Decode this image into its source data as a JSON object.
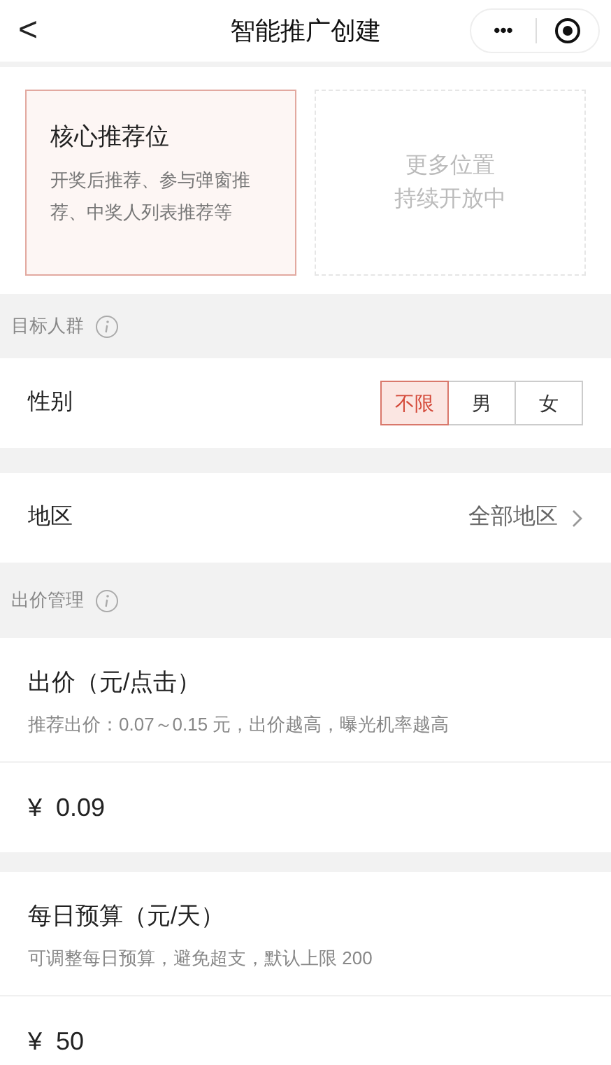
{
  "header": {
    "back": "<",
    "title": "智能推广创建",
    "more": "•••"
  },
  "placements": [
    {
      "kind": "option",
      "selected": true,
      "title": "核心推荐位",
      "description": "开奖后推荐、参与弹窗推荐、中奖人列表推荐等"
    },
    {
      "kind": "placeholder",
      "selected": false,
      "lines": [
        "更多位置",
        "持续开放中"
      ]
    }
  ],
  "audience": {
    "label": "目标人群",
    "gender": {
      "label": "性别",
      "options": [
        {
          "label": "不限",
          "selected": true
        },
        {
          "label": "男",
          "selected": false
        },
        {
          "label": "女",
          "selected": false
        }
      ]
    },
    "region": {
      "label": "地区",
      "value": "全部地区"
    }
  },
  "bidding": {
    "label": "出价管理",
    "fields": [
      {
        "title": "出价（元/点击）",
        "hint": "推荐出价：0.07～0.15 元，出价越高，曝光机率越高",
        "currency": "¥",
        "value": "0.09"
      },
      {
        "title": "每日预算（元/天）",
        "hint": "可调整每日预算，避免超支，默认上限 200",
        "currency": "¥",
        "value": "50"
      }
    ]
  }
}
